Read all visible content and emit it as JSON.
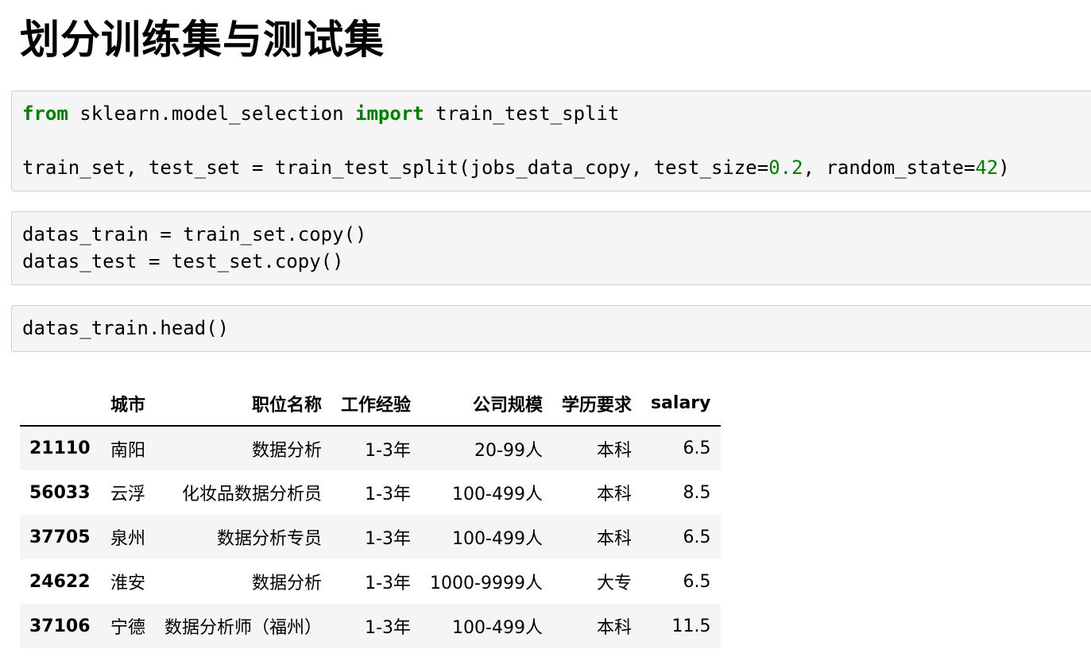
{
  "heading": "划分训练集与测试集",
  "cells": [
    {
      "line1": {
        "kw1": "from",
        "mod": " sklearn.model_selection ",
        "kw2": "import",
        "name": " train_test_split"
      },
      "line3": {
        "prefix": "train_set, test_set = train_test_split(jobs_data_copy, test_size=",
        "n1": "0.2",
        "mid": ", random_state=",
        "n2": "42",
        "suffix": ")"
      }
    },
    {
      "line1": "datas_train = train_set.copy()",
      "line2": "datas_test = test_set.copy()"
    },
    {
      "line1": "datas_train.head()"
    }
  ],
  "table": {
    "columns": [
      "",
      "城市",
      "职位名称",
      "工作经验",
      "公司规模",
      "学历要求",
      "salary"
    ],
    "rows": [
      {
        "index": "21110",
        "city": "南阳",
        "title": "数据分析",
        "exp": "1-3年",
        "size": "20-99人",
        "edu": "本科",
        "salary": "6.5"
      },
      {
        "index": "56033",
        "city": "云浮",
        "title": "化妆品数据分析员",
        "exp": "1-3年",
        "size": "100-499人",
        "edu": "本科",
        "salary": "8.5"
      },
      {
        "index": "37705",
        "city": "泉州",
        "title": "数据分析专员",
        "exp": "1-3年",
        "size": "100-499人",
        "edu": "本科",
        "salary": "6.5"
      },
      {
        "index": "24622",
        "city": "淮安",
        "title": "数据分析",
        "exp": "1-3年",
        "size": "1000-9999人",
        "edu": "大专",
        "salary": "6.5"
      },
      {
        "index": "37106",
        "city": "宁德",
        "title": "数据分析师（福州）",
        "exp": "1-3年",
        "size": "100-499人",
        "edu": "本科",
        "salary": "11.5"
      }
    ]
  }
}
